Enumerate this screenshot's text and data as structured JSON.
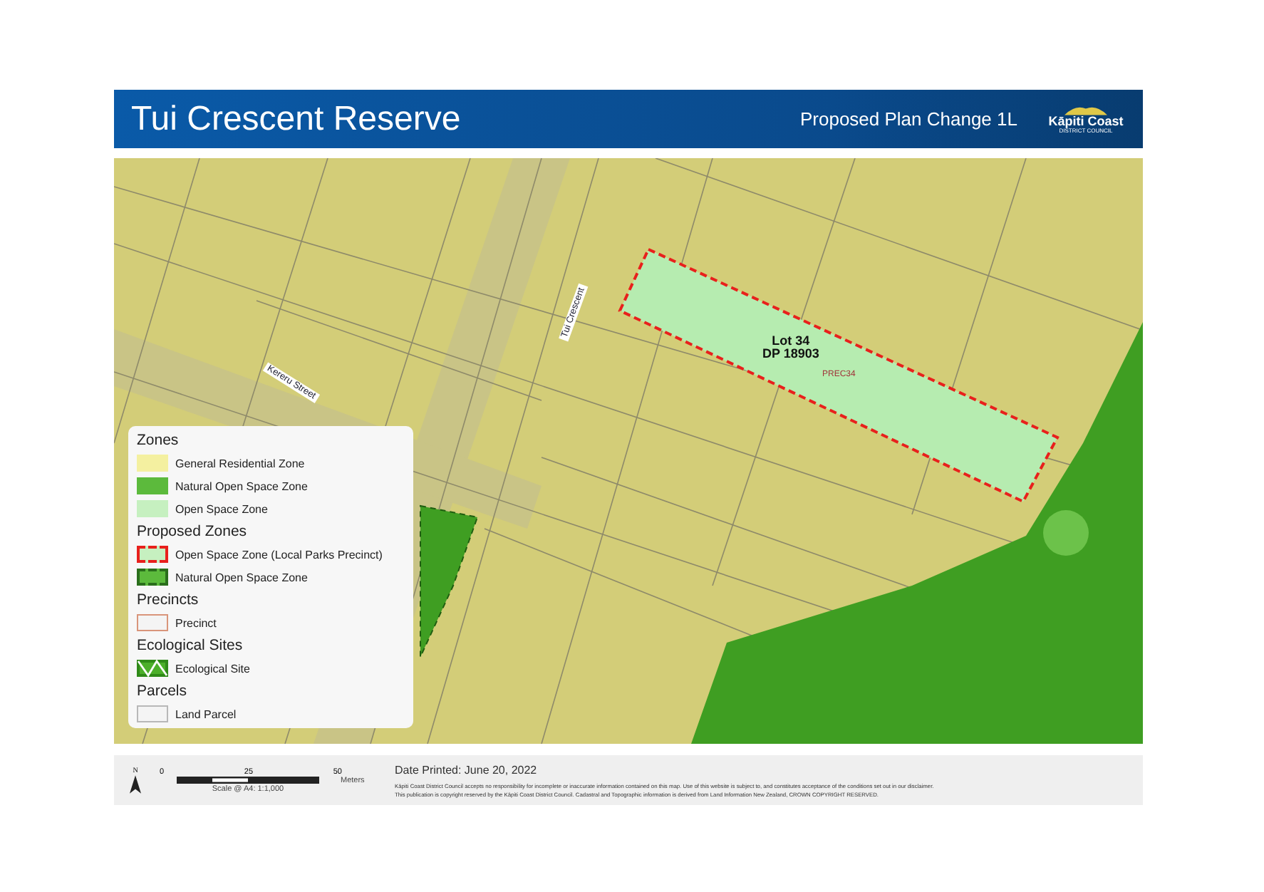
{
  "header": {
    "title": "Tui Crescent Reserve",
    "subtitle": "Proposed Plan Change 1L",
    "logo": {
      "name": "Kāpiti Coast",
      "sub": "DISTRICT COUNCIL"
    }
  },
  "map": {
    "street_labels": [
      {
        "text": "Kereru Street",
        "kind": "west"
      },
      {
        "text": "Tui Crescent",
        "kind": "north"
      }
    ],
    "lot_label": [
      "Lot 34",
      "DP 18903"
    ],
    "precinct_label": "PREC34"
  },
  "legend": {
    "groups": [
      {
        "title": "Zones",
        "items": [
          {
            "label": "General Residential Zone",
            "kind": "fill",
            "color": "#f4f0a0"
          },
          {
            "label": "Natural Open Space Zone",
            "kind": "fill",
            "color": "#5cba3c"
          },
          {
            "label": "Open Space Zone",
            "kind": "fill",
            "color": "#c6f0c0"
          }
        ]
      },
      {
        "title": "Proposed Zones",
        "items": [
          {
            "label": "Open Space Zone (Local Parks Precinct)",
            "kind": "park",
            "color": "#c6f0c0"
          },
          {
            "label": "Natural Open Space Zone",
            "kind": "natural",
            "color": "#5cba3c"
          }
        ]
      },
      {
        "title": "Precincts",
        "items": [
          {
            "label": "Precinct",
            "kind": "outline",
            "color": "#d9957a"
          }
        ]
      },
      {
        "title": "Ecological Sites",
        "items": [
          {
            "label": "Ecological Site",
            "kind": "hatch",
            "color": "#4caf2a"
          }
        ]
      },
      {
        "title": "Parcels",
        "items": [
          {
            "label": "Land Parcel",
            "kind": "outline",
            "color": "#b8b8b8"
          }
        ]
      }
    ]
  },
  "footer": {
    "north": "N",
    "scale": {
      "ticks": [
        "0",
        "25",
        "50"
      ],
      "unit": "Meters",
      "caption": "Scale @ A4: 1:1,000"
    },
    "date": "Date Printed: June 20, 2022",
    "disclaimer": [
      "Kāpiti Coast District Council accepts no responsibility for incomplete or inaccurate information contained on this map. Use of this website is subject to, and constitutes acceptance of the conditions set out in our disclaimer.",
      "This publication is copyright reserved by the Kāpiti Coast District Council. Cadastral and Topographic information is derived from Land Information New Zealand, CROWN COPYRIGHT RESERVED."
    ]
  }
}
